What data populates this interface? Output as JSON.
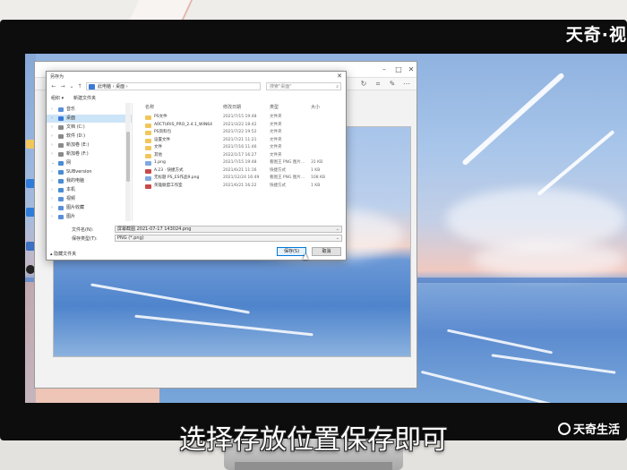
{
  "branding": {
    "top_logo": "天奇·视",
    "bottom_logo": "天奇生活"
  },
  "subtitle": "选择存放位置保存即可",
  "dialog": {
    "title": "另存为",
    "close_glyph": "✕",
    "address_path": "此电脑 › 桌面 ›",
    "search_placeholder": "搜索\"桌面\"",
    "toolbar": {
      "organize_label": "组织 ▾",
      "new_folder_label": "新建文件夹"
    },
    "nav_items": [
      {
        "label": "音乐",
        "arrow": "›",
        "color": "#5a8fd8"
      },
      {
        "label": "桌面",
        "arrow": "›",
        "color": "#3a79d8",
        "selected": true
      },
      {
        "label": "文档 (C:)",
        "arrow": "›",
        "color": "#8a8a8a"
      },
      {
        "label": "软件 (D:)",
        "arrow": "›",
        "color": "#8a8a8a"
      },
      {
        "label": "新加卷 (E:)",
        "arrow": "›",
        "color": "#8a8a8a"
      },
      {
        "label": "新加卷 (F:)",
        "arrow": "›",
        "color": "#8a8a8a"
      },
      {
        "label": "网",
        "arrow": "⌄",
        "color": "#4a8bd3"
      },
      {
        "label": "SUBversion",
        "arrow": "›",
        "color": "#4a8bd3"
      },
      {
        "label": "我的电脑",
        "arrow": "›",
        "color": "#4a8bd3"
      },
      {
        "label": "本机",
        "arrow": "›",
        "color": "#4a8bd3"
      },
      {
        "label": "视频",
        "arrow": "›",
        "color": "#5a8fd8"
      },
      {
        "label": "图片收藏",
        "arrow": "›",
        "color": "#5a8fd8"
      },
      {
        "label": "图片",
        "arrow": "›",
        "color": "#5a8fd8"
      }
    ],
    "columns": [
      "名称",
      "修改日期",
      "类型",
      "大小"
    ],
    "files": [
      {
        "name": "PS文件",
        "date": "2021/7/15 19:48",
        "type": "文件夹",
        "size": "",
        "icon": "folder"
      },
      {
        "name": "ARCTURIS_PRO_2.4.1_WIN64",
        "date": "2021/3/22 18:42",
        "type": "文件夹",
        "size": "",
        "icon": "folder"
      },
      {
        "name": "PS资料包",
        "date": "2021/7/22 19:52",
        "type": "文件夹",
        "size": "",
        "icon": "folder"
      },
      {
        "name": "设置文件",
        "date": "2021/7/21 11:21",
        "type": "文件夹",
        "size": "",
        "icon": "folder"
      },
      {
        "name": "文件",
        "date": "2021/7/16 11:46",
        "type": "文件夹",
        "size": "",
        "icon": "folder"
      },
      {
        "name": "其他",
        "date": "2022/1/17 16:27",
        "type": "文件夹",
        "size": "",
        "icon": "folder"
      },
      {
        "name": "1.png",
        "date": "2021/7/15 19:48",
        "type": "看图王 PNG 图片...",
        "size": "31 KB",
        "icon": "image"
      },
      {
        "name": "A.23 · 快捷方式",
        "date": "2021/6/21 11:16",
        "type": "快捷方式",
        "size": "1 KB",
        "icon": "shortcut"
      },
      {
        "name": "无标题 PS_ES作品9.png",
        "date": "2021/12/24 16:49",
        "type": "看图王 PNG 图片...",
        "size": "108 KB",
        "icon": "image"
      },
      {
        "name": "英雄联盟工作室",
        "date": "2021/6/21 16:22",
        "type": "快捷方式",
        "size": "1 KB",
        "icon": "shortcut"
      }
    ],
    "filename_label": "文件名(N):",
    "filename_value": "屏幕截图 2021-07-17 143024.png",
    "filetype_label": "保存类型(T):",
    "filetype_value": "PNG (*.png)",
    "hide_folders_label": "▴ 隐藏文件夹",
    "save_button": "保存(S)",
    "cancel_button": "取消"
  },
  "colors": {
    "selection": "#cce4f7",
    "accent": "#0078d7",
    "folder": "#f1c75b"
  }
}
